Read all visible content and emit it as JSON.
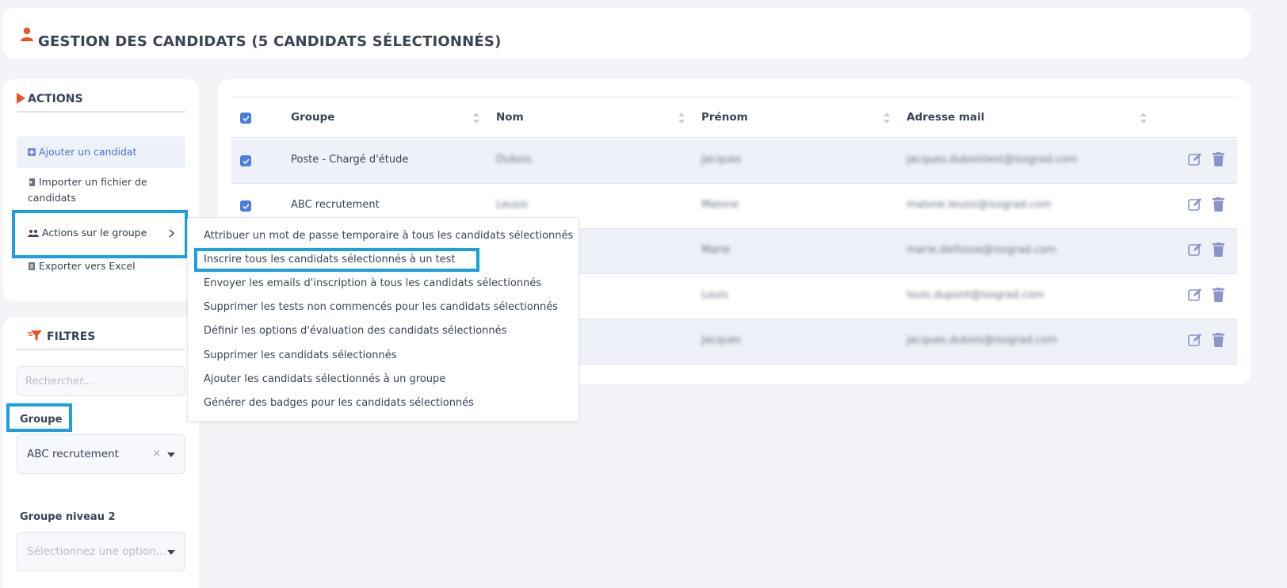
{
  "header": {
    "title": "GESTION DES CANDIDATS (5 CANDIDATS SÉLECTIONNÉS)"
  },
  "actions": {
    "title": "ACTIONS",
    "items": [
      {
        "label": "Ajouter un candidat"
      },
      {
        "label": "Importer un fichier de candidats"
      },
      {
        "label": "Actions sur le groupe"
      },
      {
        "label": "Exporter vers Excel"
      }
    ]
  },
  "filters": {
    "title": "FILTRES",
    "search_placeholder": "Rechercher...",
    "group_label": "Groupe",
    "group_value": "ABC recrutement",
    "group_clear": "×",
    "group2_label": "Groupe niveau 2",
    "group2_placeholder": "Sélectionnez une option..."
  },
  "table": {
    "columns": [
      "Groupe",
      "Nom",
      "Prénom",
      "Adresse mail"
    ],
    "rows": [
      {
        "groupe": "Poste - Chargé d'étude",
        "nom": "Dubois",
        "prenom": "Jacques",
        "email": "jacques.duboistest@isograd.com"
      },
      {
        "groupe": "ABC recrutement",
        "nom": "Leussi",
        "prenom": "Malone",
        "email": "malone.leussi@isograd.com"
      },
      {
        "groupe": "",
        "nom": "",
        "prenom": "Marie",
        "email": "marie.delfosse@isograd.com"
      },
      {
        "groupe": "",
        "nom": "",
        "prenom": "Louis",
        "email": "louis.dupont@isograd.com"
      },
      {
        "groupe": "",
        "nom": "",
        "prenom": "Jacques",
        "email": "jacques.dubois@isograd.com"
      }
    ]
  },
  "group_menu": {
    "items": [
      "Attribuer un mot de passe temporaire à tous les candidats sélectionnés",
      "Inscrire tous les candidats sélectionnés à un test",
      "Envoyer les emails d'inscription à tous les candidats sélectionnés",
      "Supprimer les tests non commencés pour les candidats sélectionnés",
      "Définir les options d'évaluation des candidats sélectionnés",
      "Supprimer les candidats sélectionnés",
      "Ajouter les candidats sélectionnés à un groupe",
      "Générer des badges pour les candidats sélectionnés"
    ]
  },
  "colors": {
    "accent": "#e8532b",
    "highlight": "#1aa0e0",
    "checkbox": "#4a7de0",
    "icon": "#8c93c6"
  }
}
